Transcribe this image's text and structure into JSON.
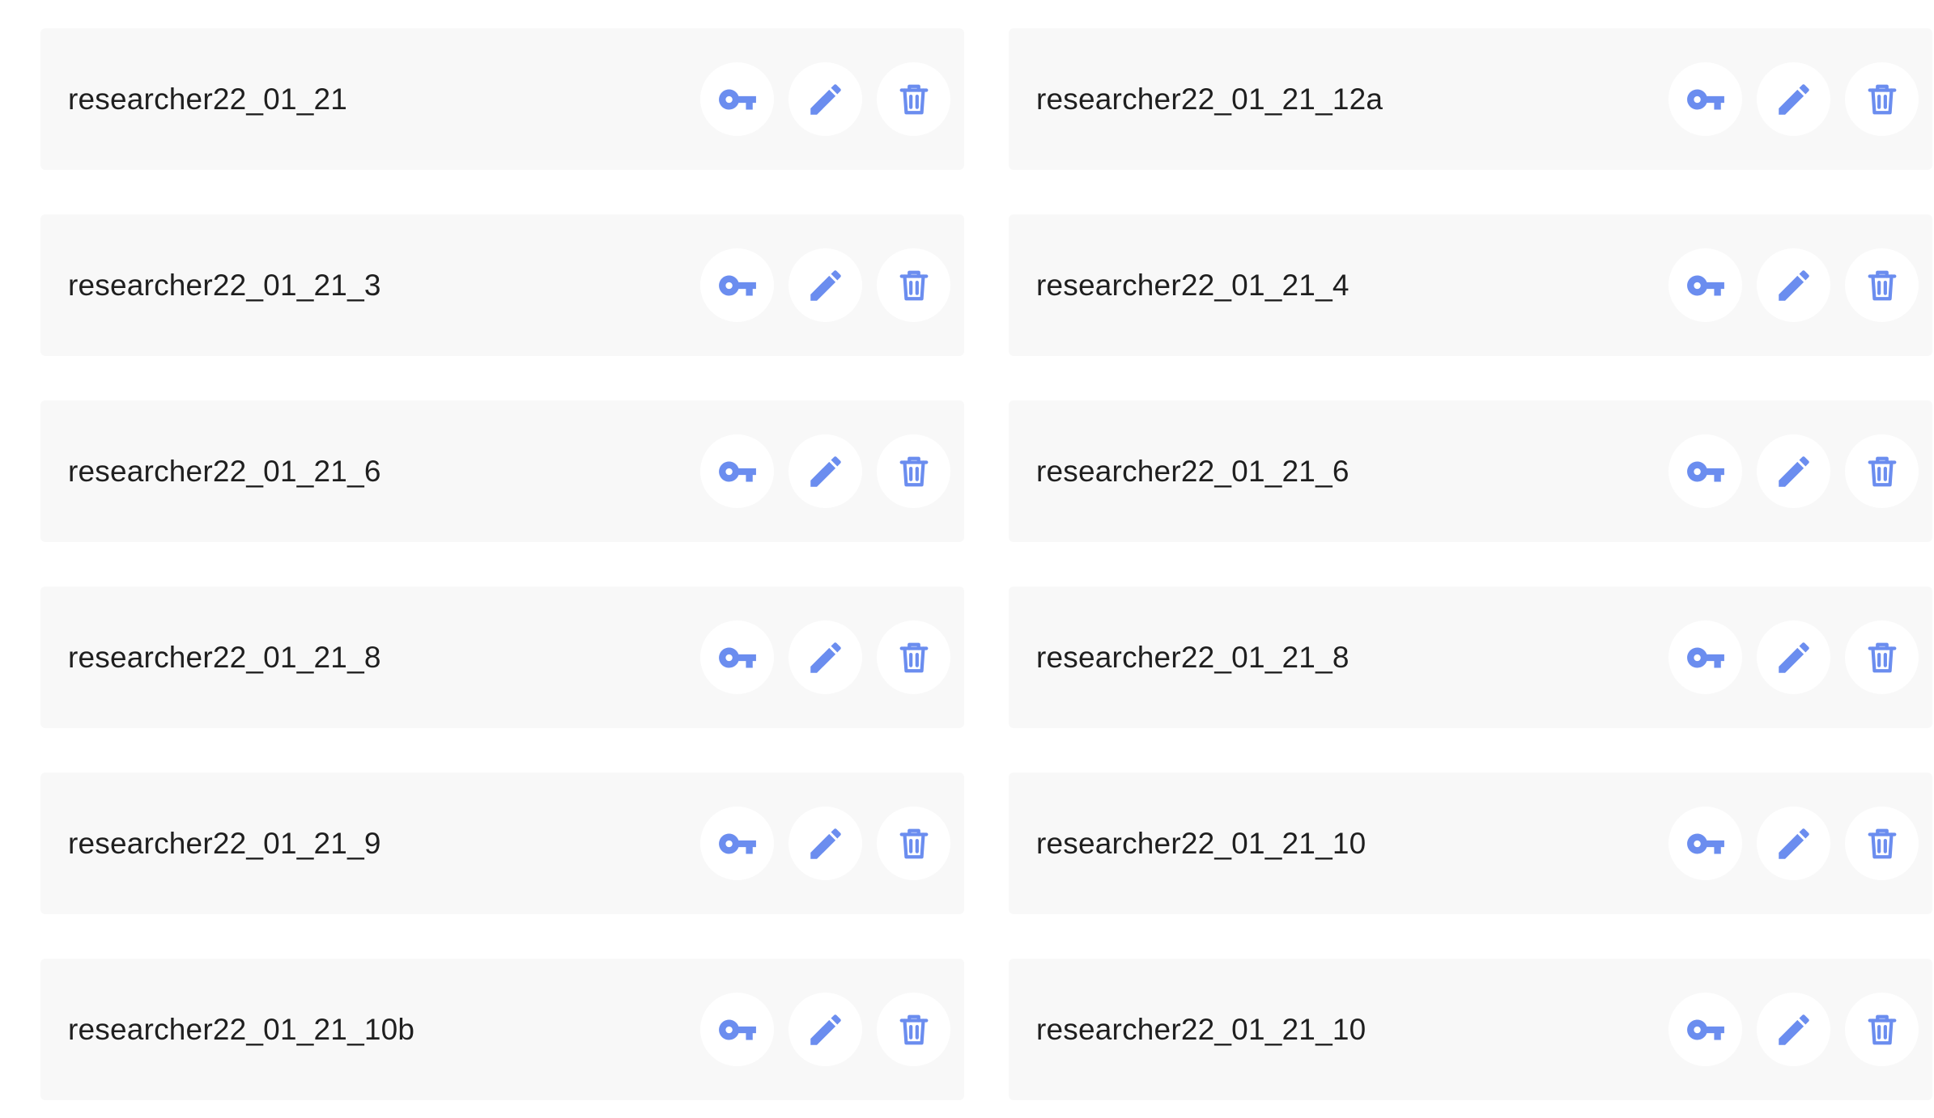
{
  "icons": {
    "key": "key-icon",
    "edit": "pencil-icon",
    "delete": "trash-icon"
  },
  "colors": {
    "card_background": "#f8f8f8",
    "icon": "#6b8def",
    "text": "#1f1f1f"
  },
  "users": [
    {
      "name": "researcher22_01_21"
    },
    {
      "name": "researcher22_01_21_12a"
    },
    {
      "name": "researcher22_01_21_3"
    },
    {
      "name": "researcher22_01_21_4"
    },
    {
      "name": "researcher22_01_21_6"
    },
    {
      "name": "researcher22_01_21_6"
    },
    {
      "name": "researcher22_01_21_8"
    },
    {
      "name": "researcher22_01_21_8"
    },
    {
      "name": "researcher22_01_21_9"
    },
    {
      "name": "researcher22_01_21_10"
    },
    {
      "name": "researcher22_01_21_10b"
    },
    {
      "name": "researcher22_01_21_10"
    }
  ]
}
